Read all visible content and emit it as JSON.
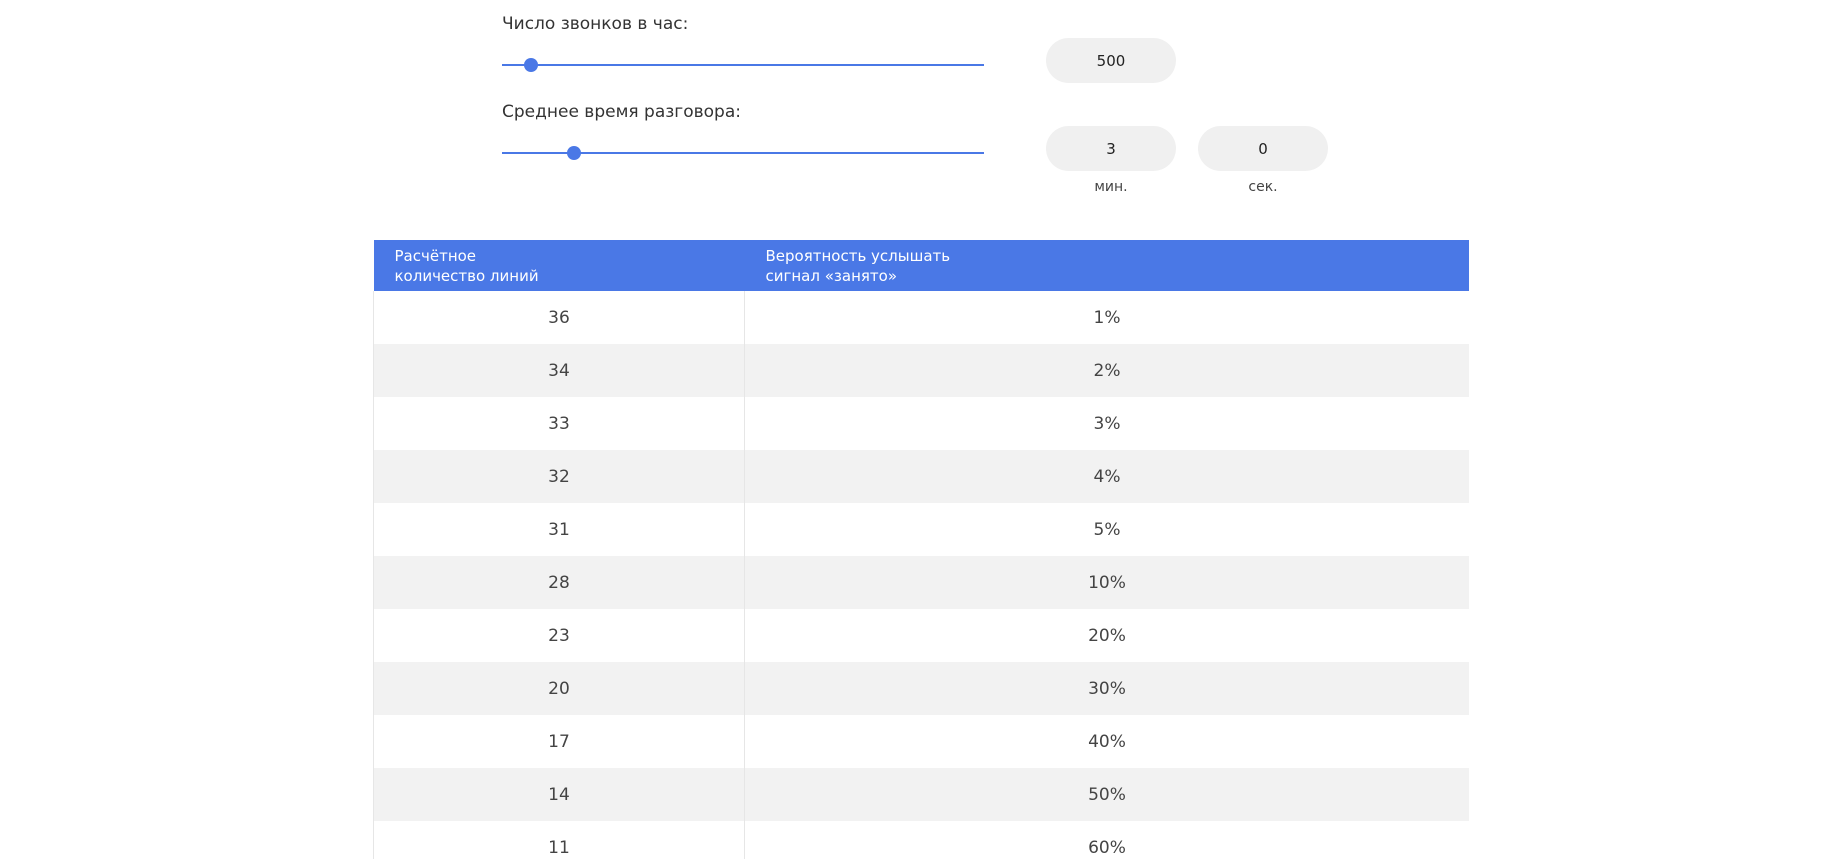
{
  "calls": {
    "label": "Число звонков в час:",
    "value": "500",
    "slider_fraction": 0.06
  },
  "duration": {
    "label": "Среднее время разговора:",
    "minutes": "3",
    "seconds": "0",
    "minutes_unit": "мин.",
    "seconds_unit": "сек.",
    "slider_fraction": 0.15
  },
  "table": {
    "headers": [
      [
        "Расчётное",
        "количество линий"
      ],
      [
        "Вероятность услышать",
        "сигнал «занято»"
      ]
    ],
    "rows": [
      [
        "36",
        "1%"
      ],
      [
        "34",
        "2%"
      ],
      [
        "33",
        "3%"
      ],
      [
        "32",
        "4%"
      ],
      [
        "31",
        "5%"
      ],
      [
        "28",
        "10%"
      ],
      [
        "23",
        "20%"
      ],
      [
        "20",
        "30%"
      ],
      [
        "17",
        "40%"
      ],
      [
        "14",
        "50%"
      ],
      [
        "11",
        "60%"
      ]
    ]
  },
  "colors": {
    "accent": "#4a78e6",
    "pill_bg": "#f0f0f0",
    "row_alt": "#f2f2f2"
  }
}
